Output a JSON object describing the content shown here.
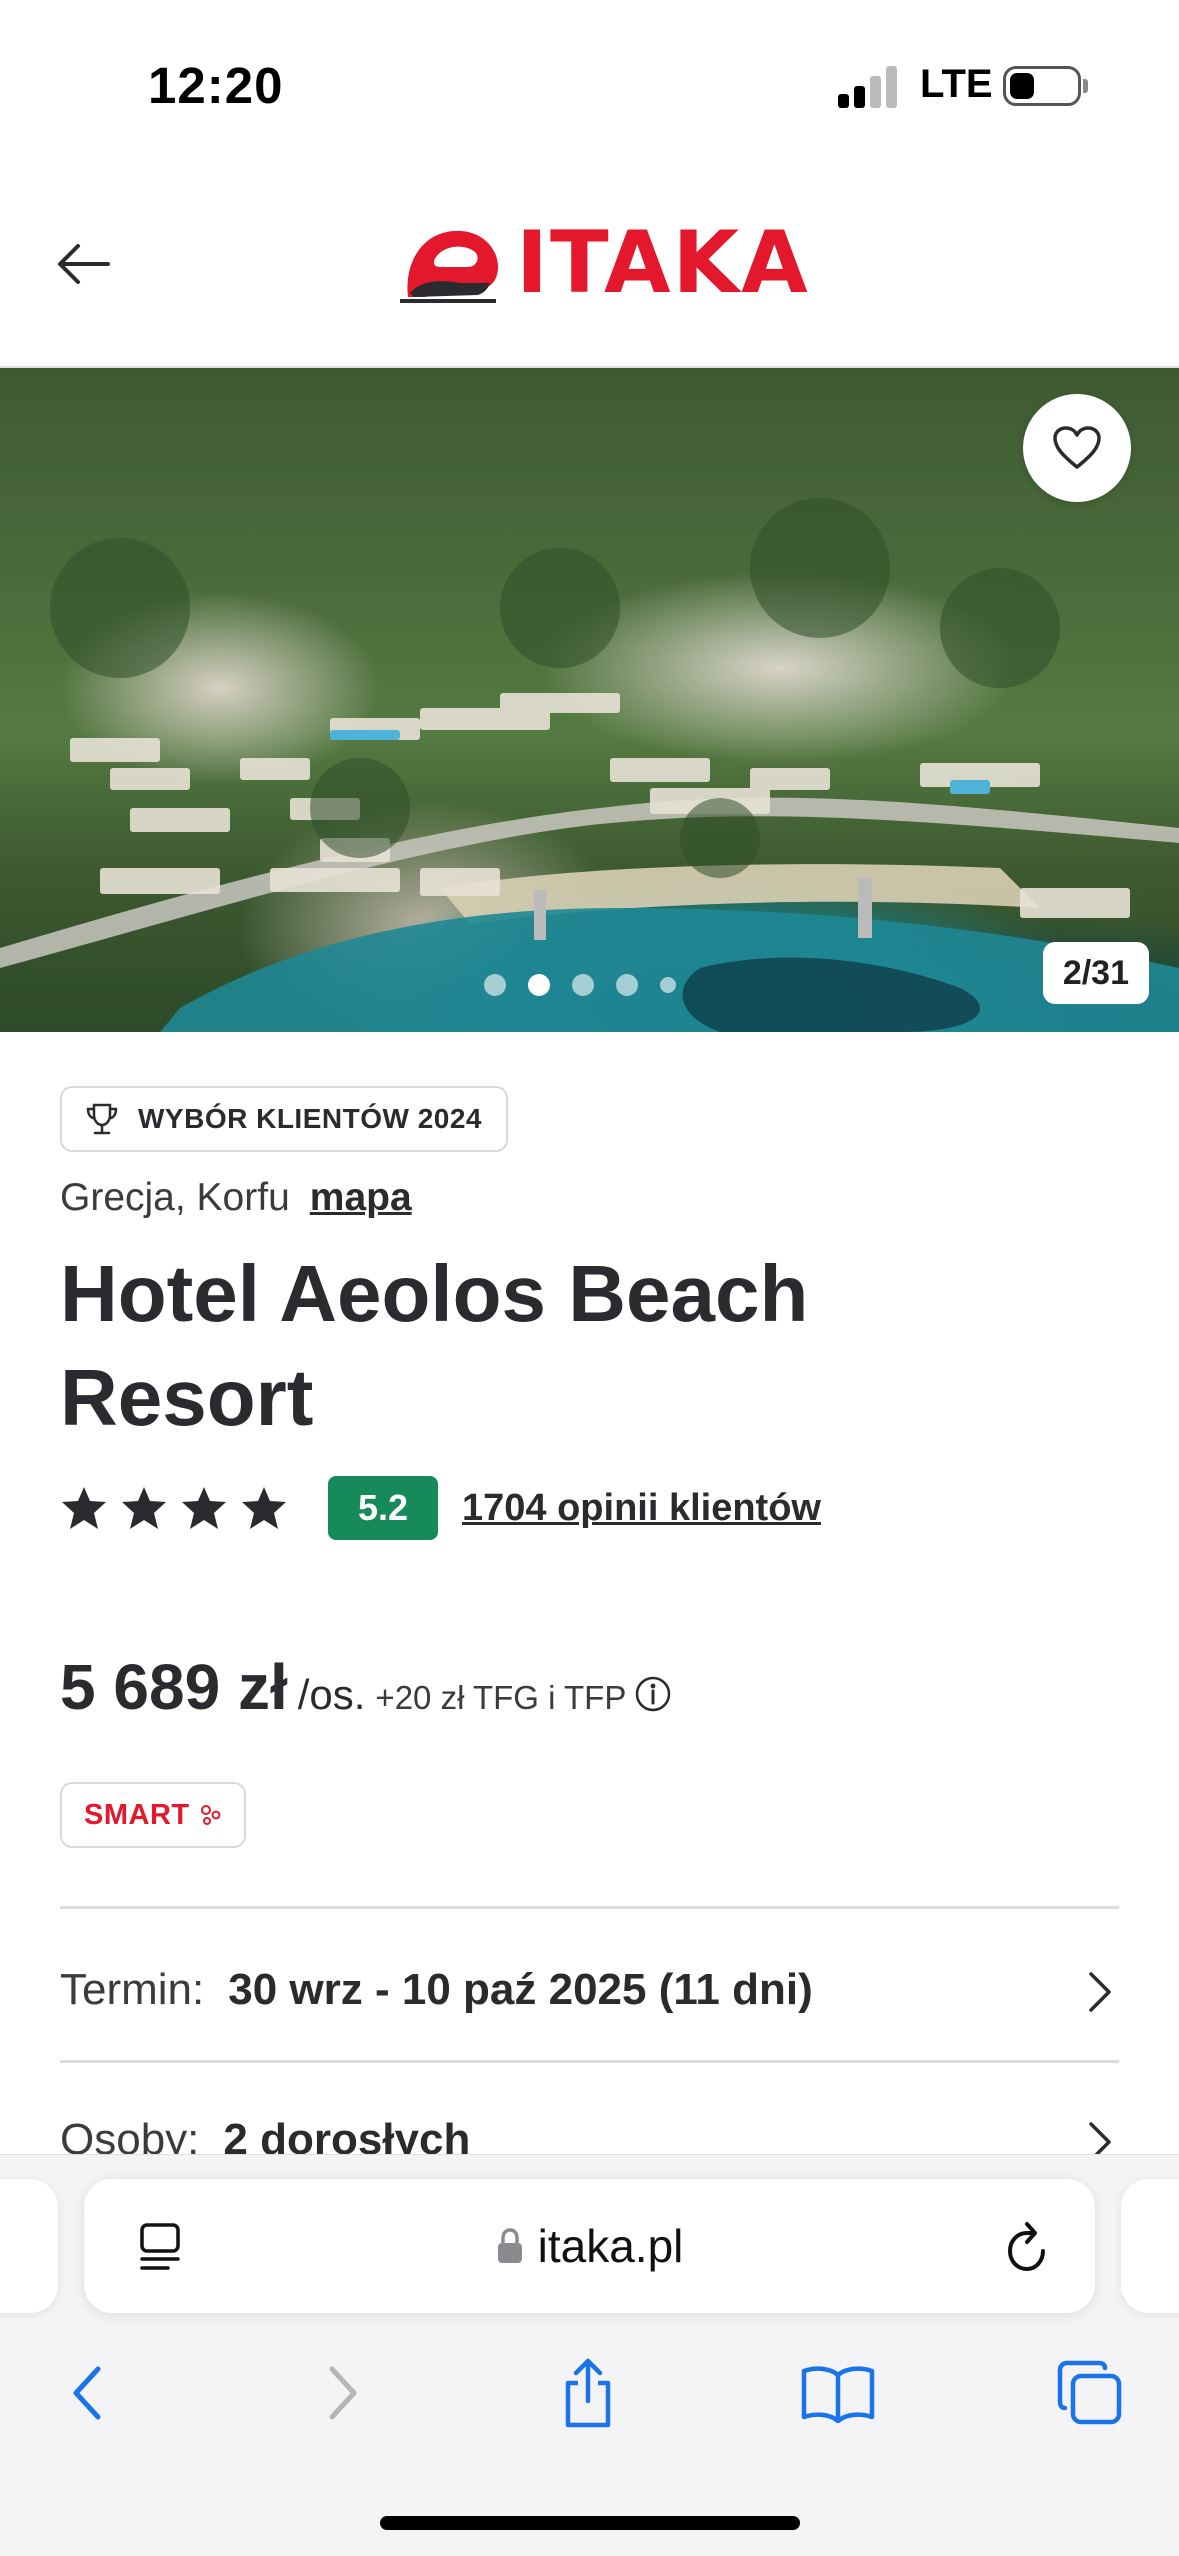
{
  "status_bar": {
    "time": "12:20",
    "network": "LTE"
  },
  "header": {
    "logo_text": "ITAKA",
    "brand_color": "#e3182d"
  },
  "gallery": {
    "counter": "2/31",
    "dots": 5,
    "active_dot": 1
  },
  "badge": {
    "label": "WYBÓR KLIENTÓW 2024"
  },
  "location": {
    "text": "Grecja, Korfu",
    "map_link": "mapa"
  },
  "hotel": {
    "title": "Hotel Aeolos Beach Resort",
    "stars": 4,
    "score": "5.2",
    "score_color": "#178a5c",
    "reviews": "1704 opinii klientów"
  },
  "price": {
    "amount": "5 689 zł",
    "per": "/os.",
    "fees": "+20 zł TFG i TFP"
  },
  "tag": {
    "label": "SMART"
  },
  "details": {
    "term_label": "Termin:",
    "term_value": "30 wrz - 10 paź 2025 (11 dni)",
    "persons_label": "Osoby:",
    "persons_value": "2 dorosłych"
  },
  "browser": {
    "url": "itaka.pl",
    "accent": "#1a73e8"
  }
}
